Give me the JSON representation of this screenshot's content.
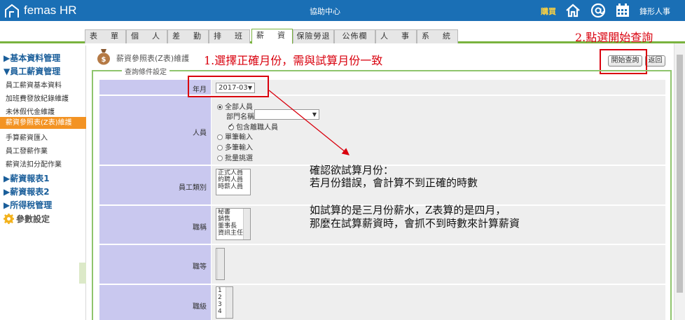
{
  "topbar": {
    "logo_text": "femas HR",
    "help_center": "協助中心",
    "buy": "購買",
    "company": "鋒形人事"
  },
  "tabs": [
    "表　單",
    "個　人",
    "差　勤",
    "排　班",
    "薪　資",
    "保險勞退",
    "公佈欄",
    "人　事",
    "系　統"
  ],
  "annotations": {
    "step1": "1.選擇正確月份，需與試算月份一致",
    "step2": "2.點選開始查詢",
    "note_line1": "確認欲試算月份：",
    "note_line2": "若月份錯誤，會計算不到正確的時數",
    "note_line3": "如試算的是三月份薪水，Z表算的是四月，",
    "note_line4": "那麼在試算薪資時，會抓不到時數來計算薪資"
  },
  "sidebar": {
    "group_basic": "▶基本資料管理",
    "group_salary": "▼員工薪資管理",
    "items": [
      "員工薪資基本資料",
      "加班費發放紀錄維護",
      "未休假代金維護",
      "薪資參照表(Z表)維護",
      "手算薪資匯入",
      "員工發薪作業",
      "薪資法扣分配作業"
    ],
    "group_report1": "▶薪資報表1",
    "group_report2": "▶薪資報表2",
    "group_tax": "▶所得稅管理",
    "params": "參數設定"
  },
  "main": {
    "title": "薪資參照表(Z表)維護",
    "start_query": "開始查詢",
    "back": "返回",
    "legend": "查詢條件設定"
  },
  "form": {
    "year_month_label": "年月",
    "year_month_value": "2017-03",
    "person_label": "人員",
    "radio_all": "全部人員",
    "dept_label": "部門名稱",
    "dept_value": "",
    "include_resigned": "包含離職人員",
    "radio_single": "單筆輸入",
    "radio_multi": "多筆輸入",
    "radio_batch": "批量挑選",
    "emp_type_label": "員工類別",
    "emp_type_options": [
      "正式人員",
      "約聘人員",
      "時薪人員"
    ],
    "title_label": "職稱",
    "title_options": [
      "秘書",
      "銷售",
      "董事長",
      "資訊主任"
    ],
    "grade_label": "職等",
    "grade_options": [],
    "level_label": "職級",
    "level_options": [
      "1",
      "2",
      "3",
      "4"
    ]
  },
  "colors": {
    "topbar": "#1a6fb5",
    "tab_accent": "#79b33e",
    "label_bg": "#c9c8ef",
    "active_sidebar": "#f39323",
    "annotation": "#d9000d"
  }
}
